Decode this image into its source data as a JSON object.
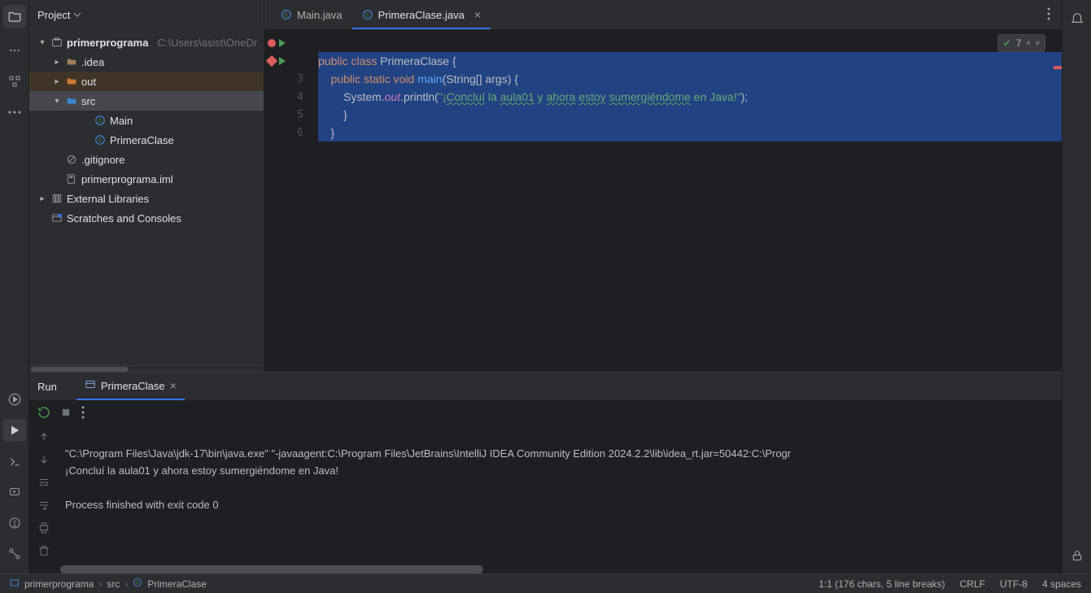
{
  "panel": {
    "title": "Project"
  },
  "tree": {
    "root": "primerprograma",
    "root_hint": "C:\\Users\\asist\\OneDr",
    "idea": ".idea",
    "out": "out",
    "src": "src",
    "main": "Main",
    "primera": "PrimeraClase",
    "gitignore": ".gitignore",
    "iml": "primerprograma.iml",
    "ext_libs": "External Libraries",
    "scratches": "Scratches and Consoles"
  },
  "tabs": {
    "main": "Main.java",
    "primera": "PrimeraClase.java"
  },
  "inspection": {
    "count": "7"
  },
  "code": {
    "l1_kw_public": "public",
    "l1_kw_class": "class",
    "l1_cls": "PrimeraClase",
    "l1_brace": " {",
    "l2_kw_public": "public",
    "l2_kw_static": "static",
    "l2_kw_void": "void",
    "l2_method": "main",
    "l2_params": "(String[] args) {",
    "l3_pre": "        System.",
    "l3_out": "out",
    "l3_dot": ".println(",
    "l3_s1": "\"¡",
    "l3_t1": "Concluí",
    "l3_s2": " la ",
    "l3_t2": "aula01",
    "l3_s3": " y ",
    "l3_t3": "ahora",
    "l3_s4": " ",
    "l3_t4": "estoy",
    "l3_s5": " ",
    "l3_t5": "sumergiéndome",
    "l3_s6": " en Java!\"",
    "l3_end": ");",
    "l4": "        }",
    "l5": "    }"
  },
  "run": {
    "title": "Run",
    "tab": "PrimeraClase",
    "line1": "\"C:\\Program Files\\Java\\jdk-17\\bin\\java.exe\" \"-javaagent:C:\\Program Files\\JetBrains\\IntelliJ IDEA Community Edition 2024.2.2\\lib\\idea_rt.jar=50442:C:\\Progr",
    "line2": "¡Concluí la aula01 y ahora estoy sumergiéndome en Java!",
    "line3": "",
    "line4": "Process finished with exit code 0"
  },
  "status": {
    "bc_module": "primerprograma",
    "bc_src": "src",
    "bc_class": "PrimeraClase",
    "pos": "1:1 (176 chars, 5 line breaks)",
    "eol": "CRLF",
    "enc": "UTF-8",
    "indent": "4 spaces"
  }
}
